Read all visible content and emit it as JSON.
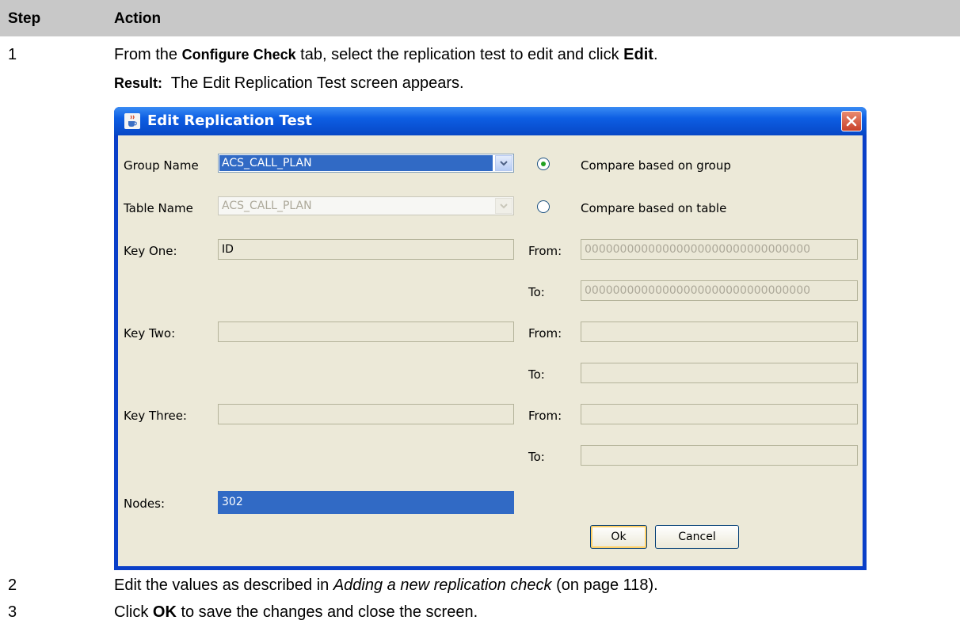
{
  "table": {
    "header_step": "Step",
    "header_action": "Action",
    "step1_num": "1",
    "step1_a": "From the ",
    "step1_b": "Configure Check",
    "step1_c": " tab, select the replication test to edit and click ",
    "step1_d": "Edit",
    "step1_e": ".",
    "result_label": "Result:",
    "result_text": "  The Edit Replication Test screen appears.",
    "step2_num": "2",
    "step2_a": "Edit the values as described in ",
    "step2_b": "Adding a new replication check",
    "step2_c": " (on page 118).",
    "step3_num": "3",
    "step3_a": "Click ",
    "step3_b": "OK",
    "step3_c": " to save the changes and close the screen."
  },
  "dialog": {
    "title": "Edit Replication Test",
    "group_name_label": "Group Name",
    "group_name_value": "ACS_CALL_PLAN",
    "table_name_label": "Table Name",
    "table_name_value": "ACS_CALL_PLAN",
    "radio_group_label": "Compare based on group",
    "radio_table_label": "Compare based on table",
    "radio_selected": "group",
    "key_one_label": "Key One:",
    "key_one_value": "ID",
    "key_two_label": "Key Two:",
    "key_two_value": "",
    "key_three_label": "Key Three:",
    "key_three_value": "",
    "from_label": "From:",
    "to_label": "To:",
    "key_one_from": "00000000000000000000000000000000",
    "key_one_to": "00000000000000000000000000000000",
    "nodes_label": "Nodes:",
    "nodes_value": "302",
    "ok_label": "Ok",
    "cancel_label": "Cancel"
  },
  "colors": {
    "header_bg": "#c8c8c8",
    "titlebar": "#0d5ee3",
    "dialog_bg": "#ece9d8",
    "selection": "#316ac5"
  }
}
